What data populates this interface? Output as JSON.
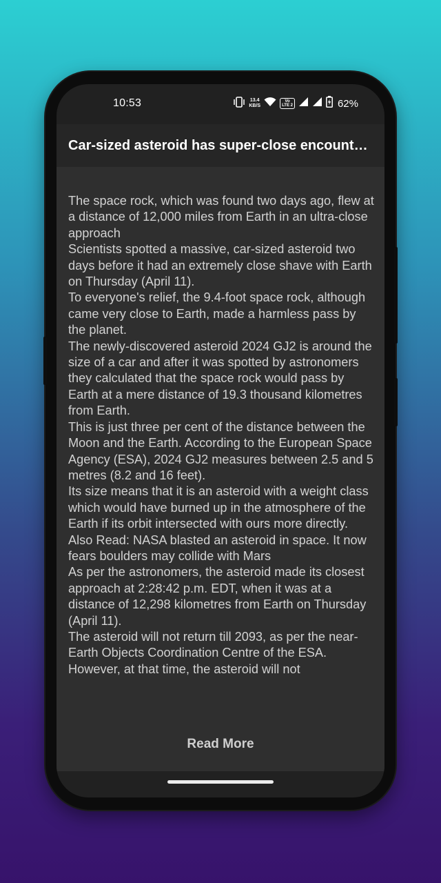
{
  "status_bar": {
    "time": "10:53",
    "net_speed_value": "13.4",
    "net_speed_unit": "KB/S",
    "volte_top": "Vo",
    "volte_bottom": "LTE 2",
    "battery_percent": "62%"
  },
  "app_bar": {
    "title": "Car-sized asteroid has super-close encounter with Earth"
  },
  "article": {
    "paragraphs": [
      "The space rock, which was found two days ago, flew at a distance of 12,000 miles from Earth in an ultra-close approach",
      "Scientists spotted a massive, car-sized asteroid two days before it had an extremely close shave with Earth on Thursday (April 11).",
      "To everyone's relief, the 9.4-foot space rock, although came very close to Earth, made a harmless pass by the planet.",
      "The newly-discovered asteroid 2024 GJ2 is around the size of a car and after it was spotted by astronomers they calculated that the space rock would pass by Earth at a mere distance of 19.3 thousand kilometres from Earth.",
      "This is just three per cent of the distance between the Moon and the Earth. According to the European Space Agency (ESA), 2024 GJ2 measures between 2.5 and 5 metres (8.2 and 16 feet).",
      "Its size means that it is an asteroid with a weight class which would have burned up in the atmosphere of the Earth if its orbit intersected with ours more directly.",
      "Also Read: NASA blasted an asteroid in space. It now fears boulders may collide with Mars",
      "As per the astronomers, the asteroid made its closest approach at 2:28:42 p.m. EDT, when it was at a distance of 12,298 kilometres from Earth on Thursday (April 11).",
      "The asteroid will not return till 2093, as per the near-Earth Objects Coordination Centre of the ESA. However, at that time, the asteroid will not"
    ],
    "read_more_label": "Read More"
  },
  "colors": {
    "background_top": "#2ccfd2",
    "background_bottom": "#37136b",
    "app_bar": "#262626",
    "content_bg": "#2f2f2f",
    "body_text": "#d2d2d2"
  }
}
